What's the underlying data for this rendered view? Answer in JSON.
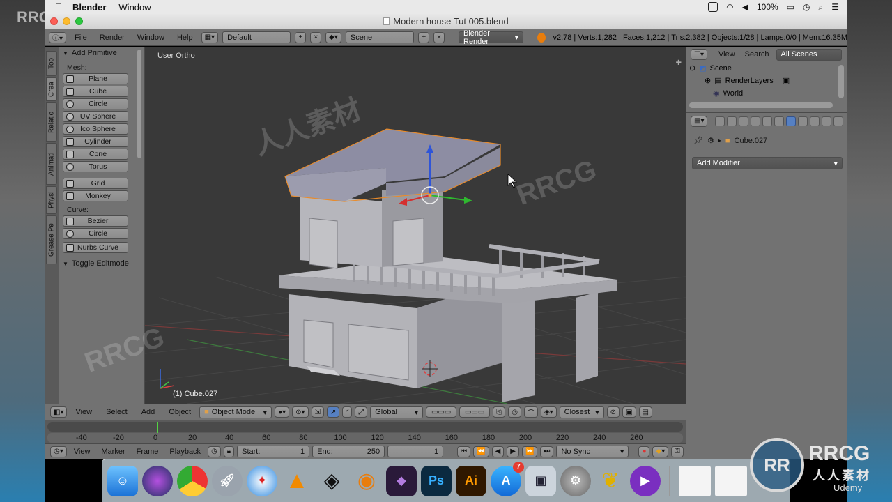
{
  "watermark": {
    "corner": "RRCG",
    "brand": "RRCG",
    "brand_cn": "人人素材",
    "logo": "RR",
    "udemy": "Udemy"
  },
  "menubar": {
    "app_name": "Blender",
    "items": [
      "Window"
    ],
    "battery": "100%"
  },
  "window": {
    "title": "Modern house Tut 005.blend"
  },
  "header": {
    "menus": [
      "File",
      "Render",
      "Window",
      "Help"
    ],
    "layout": "Default",
    "scene": "Scene",
    "engine": "Blender Render",
    "stats": "v2.78 | Verts:1,282 | Faces:1,212 | Tris:2,382 | Objects:1/28 | Lamps:0/0 | Mem:16.35M"
  },
  "tabs": [
    "Too",
    "Crea",
    "Relatio",
    "Animati",
    "Physi",
    "Grease Pe"
  ],
  "toolshelf": {
    "panel_title": "Add Primitive",
    "mesh_label": "Mesh:",
    "mesh": [
      "Plane",
      "Cube",
      "Circle",
      "UV Sphere",
      "Ico Sphere",
      "Cylinder",
      "Cone",
      "Torus"
    ],
    "mesh2": [
      "Grid",
      "Monkey"
    ],
    "curve_label": "Curve:",
    "curve": [
      "Bezier",
      "Circle",
      "Nurbs Curve"
    ],
    "toggle": "Toggle Editmode"
  },
  "viewport": {
    "view_label": "User Ortho",
    "object_label": "(1) Cube.027"
  },
  "viewport_header": {
    "menus": [
      "View",
      "Select",
      "Add",
      "Object"
    ],
    "mode": "Object Mode",
    "orientation": "Global",
    "snap": "Closest"
  },
  "timeline": {
    "ticks": [
      "-40",
      "-20",
      "0",
      "20",
      "40",
      "60",
      "80",
      "100",
      "120",
      "140",
      "160",
      "180",
      "200",
      "220",
      "240",
      "260"
    ],
    "current_frame": 1
  },
  "timeline_header": {
    "menus": [
      "View",
      "Marker",
      "Frame",
      "Playback"
    ],
    "start_label": "Start:",
    "start": "1",
    "end_label": "End:",
    "end": "250",
    "current": "1",
    "sync": "No Sync"
  },
  "outliner": {
    "menus": [
      "View",
      "Search"
    ],
    "filter": "All Scenes",
    "items": [
      "Scene",
      "RenderLayers",
      "World"
    ]
  },
  "properties": {
    "object": "Cube.027",
    "add_modifier": "Add Modifier"
  },
  "dock": {
    "apps": [
      "Finder",
      "Siri",
      "Chrome",
      "Launchpad",
      "Safari",
      "VLC",
      "Unity",
      "Blender",
      "Game",
      "Ps",
      "Ai",
      "App Store",
      "Preview",
      "System Preferences",
      "Pineapple",
      "Screenflow"
    ],
    "app_store_badge": "7"
  }
}
